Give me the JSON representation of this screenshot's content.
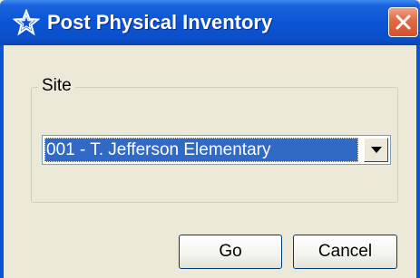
{
  "window": {
    "title": "Post Physical Inventory",
    "title_icon": "star-outline-icon",
    "close_icon": "close-icon"
  },
  "site_group": {
    "label": "Site"
  },
  "site_select": {
    "selected_value": "001 - T. Jefferson Elementary",
    "dropdown_icon": "chevron-down-icon"
  },
  "buttons": {
    "go_label": "Go",
    "cancel_label": "Cancel"
  },
  "colors": {
    "titlebar": "#0a55d6",
    "close_button": "#d4502b",
    "selection_highlight": "#316ac5",
    "dialog_background": "#ece9d8"
  }
}
